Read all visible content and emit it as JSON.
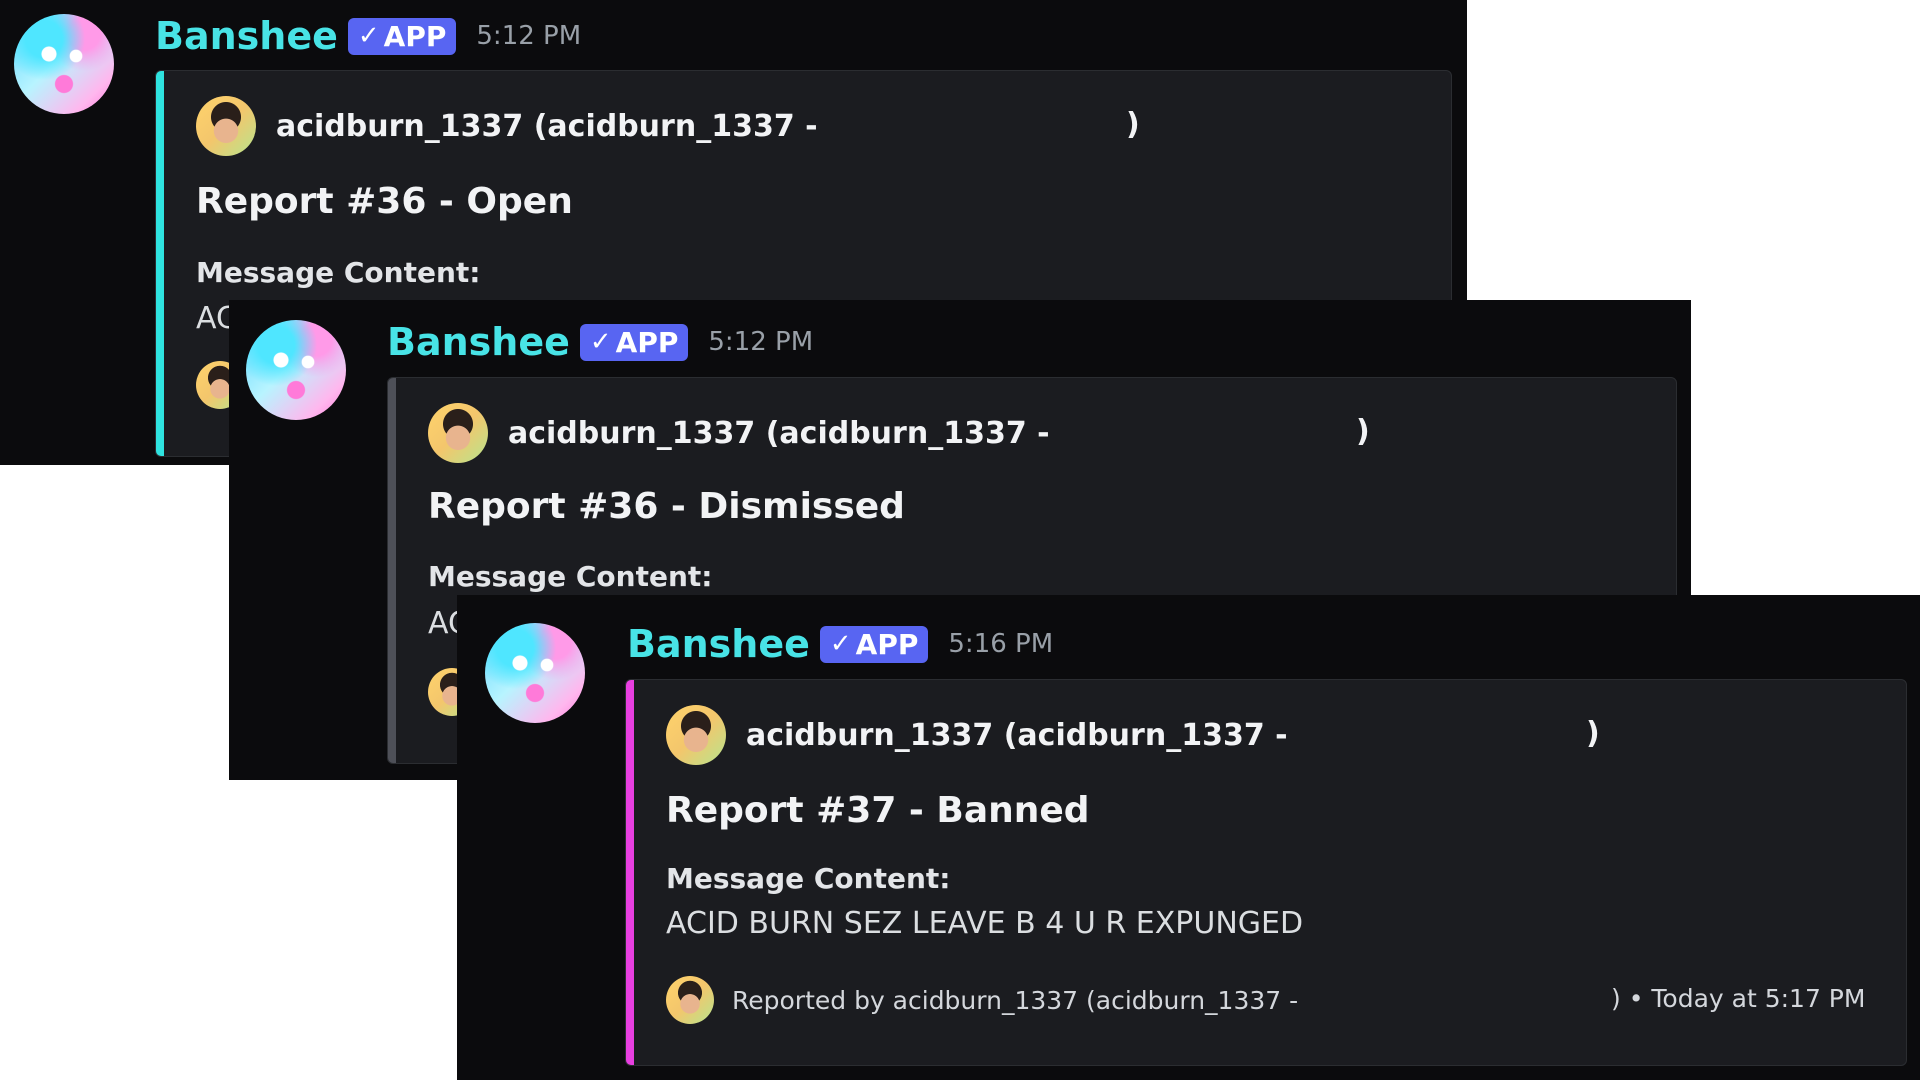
{
  "bot": {
    "name": "Banshee",
    "badge": "APP"
  },
  "messages": [
    {
      "time": "5:12 PM",
      "accent": "#2fe3e0",
      "author": "acidburn_1337 (acidburn_1337 -",
      "paren": ")",
      "title": "Report #36 - Open",
      "field_name": "Message Content:",
      "field_value": "AC"
    },
    {
      "time": "5:12 PM",
      "accent": "#4e5058",
      "author": "acidburn_1337 (acidburn_1337 -",
      "paren": ")",
      "title": "Report #36 - Dismissed",
      "field_name": "Message Content:",
      "field_value": "AC"
    },
    {
      "time": "5:16 PM",
      "accent": "#e83fe0",
      "author": "acidburn_1337 (acidburn_1337 -",
      "paren": ")",
      "title": "Report #37 - Banned",
      "field_name": "Message Content:",
      "field_value": "ACID BURN SEZ LEAVE B 4 U R EXPUNGED",
      "footer_reporter": "Reported by acidburn_1337 (acidburn_1337 -",
      "footer_tail": ") • Today at 5:17 PM"
    }
  ]
}
